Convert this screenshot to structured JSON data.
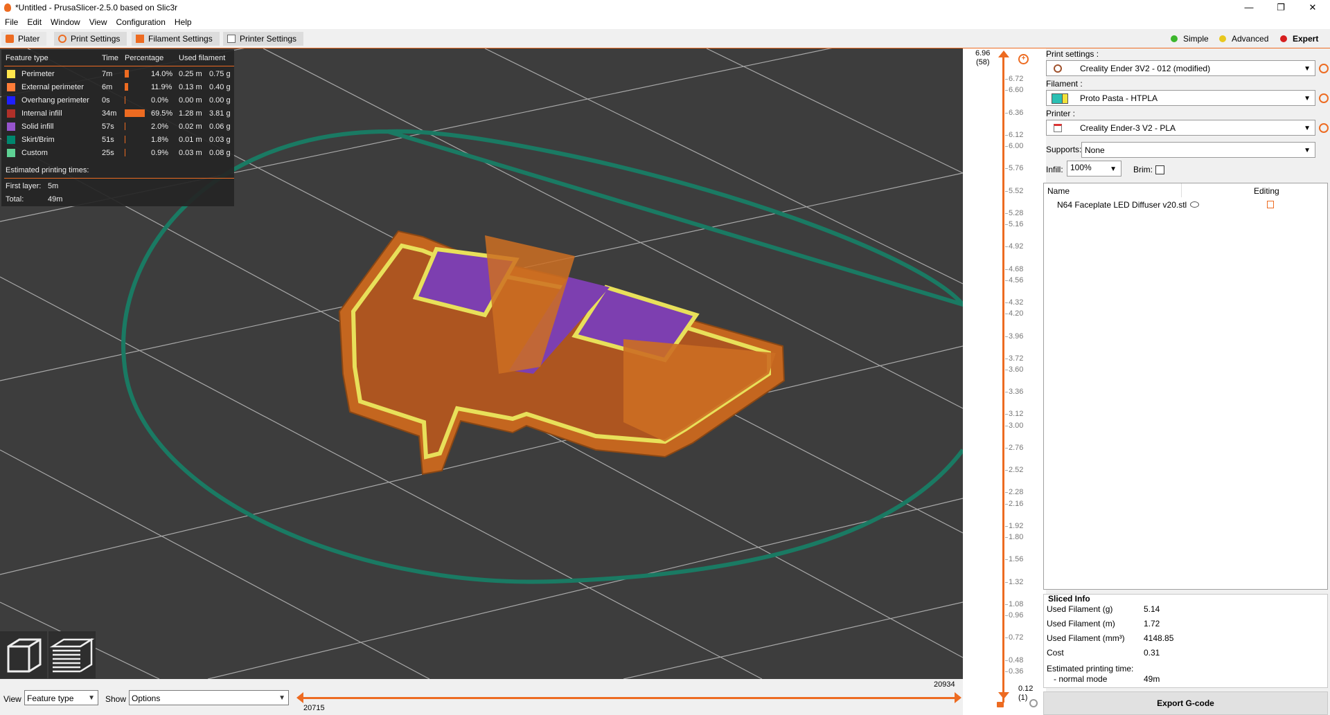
{
  "window": {
    "title": "*Untitled - PrusaSlicer-2.5.0 based on Slic3r",
    "controls": [
      "—",
      "❐",
      "✕"
    ]
  },
  "menu": [
    "File",
    "Edit",
    "Window",
    "View",
    "Configuration",
    "Help"
  ],
  "tabs": [
    {
      "label": "Plater",
      "icon": "plater-icon"
    },
    {
      "label": "Print Settings",
      "icon": "print-settings-icon"
    },
    {
      "label": "Filament Settings",
      "icon": "filament-icon"
    },
    {
      "label": "Printer Settings",
      "icon": "printer-icon"
    }
  ],
  "modes": [
    {
      "label": "Simple",
      "color": "#3cb62c"
    },
    {
      "label": "Advanced",
      "color": "#e8c81e"
    },
    {
      "label": "Expert",
      "color": "#d61e1e"
    }
  ],
  "legend": {
    "headers": {
      "feature": "Feature type",
      "time": "Time",
      "percentage": "Percentage",
      "used": "Used filament"
    },
    "rows": [
      {
        "name": "Perimeter",
        "color": "#ffe64c",
        "time": "7m",
        "pct": "14.0%",
        "pct_value": 0.14,
        "m": "0.25 m",
        "g": "0.75 g"
      },
      {
        "name": "External perimeter",
        "color": "#ff7d38",
        "time": "6m",
        "pct": "11.9%",
        "pct_value": 0.119,
        "m": "0.13 m",
        "g": "0.40 g"
      },
      {
        "name": "Overhang perimeter",
        "color": "#1f1fff",
        "time": "0s",
        "pct": "0.0%",
        "pct_value": 0.0,
        "m": "0.00 m",
        "g": "0.00 g"
      },
      {
        "name": "Internal infill",
        "color": "#b03029",
        "time": "34m",
        "pct": "69.5%",
        "pct_value": 0.695,
        "m": "1.28 m",
        "g": "3.81 g"
      },
      {
        "name": "Solid infill",
        "color": "#9654cc",
        "time": "57s",
        "pct": "2.0%",
        "pct_value": 0.02,
        "m": "0.02 m",
        "g": "0.06 g"
      },
      {
        "name": "Skirt/Brim",
        "color": "#00876e",
        "time": "51s",
        "pct": "1.8%",
        "pct_value": 0.018,
        "m": "0.01 m",
        "g": "0.03 g"
      },
      {
        "name": "Custom",
        "color": "#5ed194",
        "time": "25s",
        "pct": "0.9%",
        "pct_value": 0.009,
        "m": "0.03 m",
        "g": "0.08 g"
      }
    ],
    "est_title": "Estimated printing times:",
    "first_layer_label": "First layer:",
    "first_layer_value": "5m",
    "total_label": "Total:",
    "total_value": "49m"
  },
  "vslider": {
    "top_value": "6.96",
    "top_layer": "(58)",
    "bottom_value": "0.12",
    "bottom_layer": "(1)",
    "ticks": [
      "6.72",
      "6.60",
      "6.36",
      "6.12",
      "6.00",
      "5.76",
      "5.52",
      "5.28",
      "5.16",
      "4.92",
      "4.68",
      "4.56",
      "4.32",
      "4.20",
      "3.96",
      "3.72",
      "3.60",
      "3.36",
      "3.12",
      "3.00",
      "2.76",
      "2.52",
      "2.28",
      "2.16",
      "1.92",
      "1.80",
      "1.56",
      "1.32",
      "1.08",
      "0.96",
      "0.72",
      "0.48",
      "0.36"
    ]
  },
  "hslider": {
    "left_value": "20715",
    "right_value": "20934"
  },
  "bottom": {
    "view_label": "View",
    "view_value": "Feature type",
    "show_label": "Show",
    "show_value": "Options"
  },
  "sidebar": {
    "print_settings_label": "Print settings :",
    "print_settings_value": "Creality Ender 3V2 - 012 (modified)",
    "filament_label": "Filament :",
    "filament_value": "Proto Pasta - HTPLA",
    "printer_label": "Printer :",
    "printer_value": "Creality Ender-3 V2 - PLA",
    "supports_label": "Supports:",
    "supports_value": "None",
    "infill_label": "Infill:",
    "infill_value": "100%",
    "brim_label": "Brim:",
    "list_name_header": "Name",
    "list_editing_header": "Editing",
    "object_name": "N64 Faceplate LED Diffuser v20.stl"
  },
  "sliced_info": {
    "title": "Sliced Info",
    "rows": [
      {
        "label": "Used Filament (g)",
        "value": "5.14"
      },
      {
        "label": "Used Filament (m)",
        "value": "1.72"
      },
      {
        "label": "Used Filament (mm³)",
        "value": "4148.85"
      },
      {
        "label": "Cost",
        "value": "0.31"
      }
    ],
    "est_label": "Estimated printing time:",
    "normal_mode_label": "- normal mode",
    "normal_mode_value": "49m"
  },
  "export_label": "Export G-code"
}
